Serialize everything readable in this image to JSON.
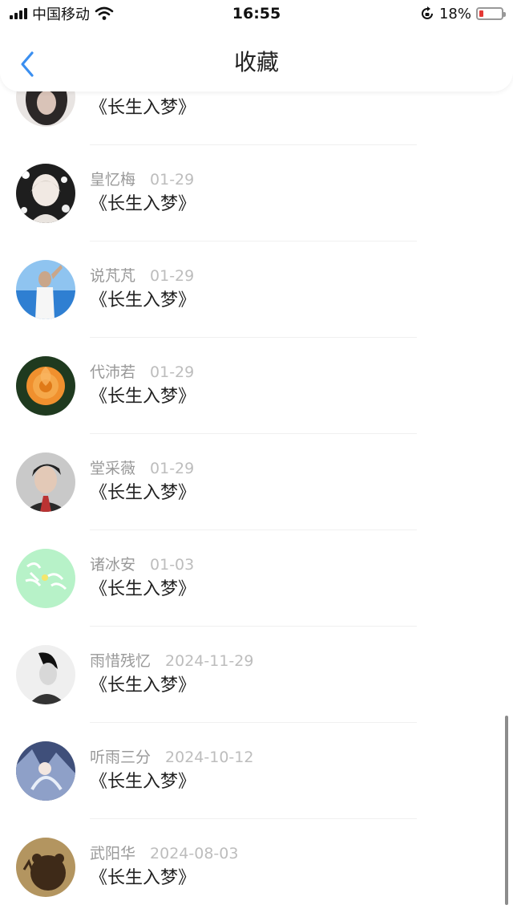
{
  "status_bar": {
    "carrier": "中国移动",
    "time": "16:55",
    "battery": "18%",
    "battery_level": 0.18
  },
  "nav": {
    "title": "收藏"
  },
  "items": [
    {
      "name": "",
      "date": "",
      "title": "《长生入梦》",
      "avatar_color": "#3a3a3a"
    },
    {
      "name": "皇忆梅",
      "date": "01-29",
      "title": "《长生入梦》",
      "avatar_color": "#2a2a2a"
    },
    {
      "name": "说芃芃",
      "date": "01-29",
      "title": "《长生入梦》",
      "avatar_color": "#4a90d9"
    },
    {
      "name": "代沛若",
      "date": "01-29",
      "title": "《长生入梦》",
      "avatar_color": "#ef8a23"
    },
    {
      "name": "堂采薇",
      "date": "01-29",
      "title": "《长生入梦》",
      "avatar_color": "#7a7a7a"
    },
    {
      "name": "诸冰安",
      "date": "01-03",
      "title": "《长生入梦》",
      "avatar_color": "#b7f2c8"
    },
    {
      "name": "雨惜残忆",
      "date": "2024-11-29",
      "title": "《长生入梦》",
      "avatar_color": "#cfcfcf"
    },
    {
      "name": "听雨三分",
      "date": "2024-10-12",
      "title": "《长生入梦》",
      "avatar_color": "#4b5d8a"
    },
    {
      "name": "武阳华",
      "date": "2024-08-03",
      "title": "《长生入梦》",
      "avatar_color": "#8a6b3e"
    }
  ]
}
